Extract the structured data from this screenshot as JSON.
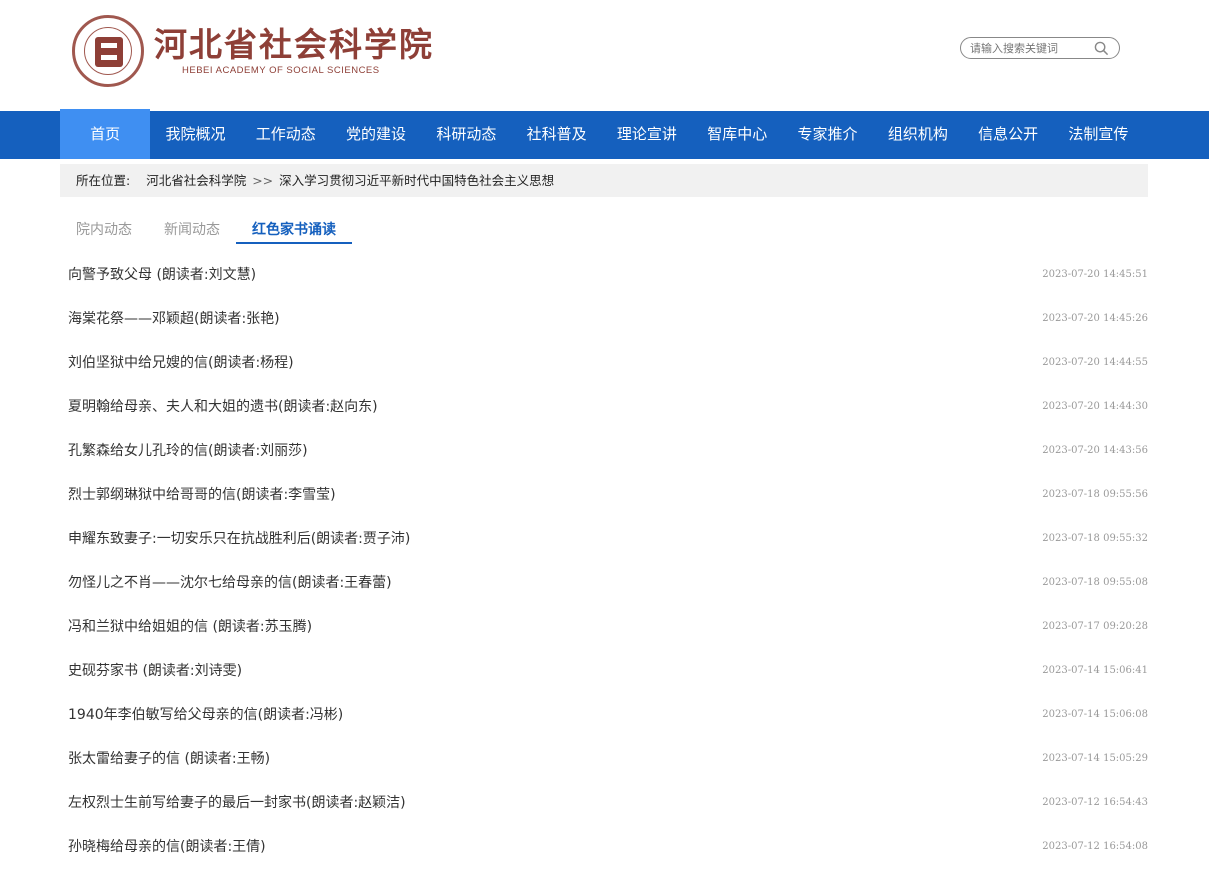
{
  "site": {
    "name_cn": "河北省社会科学院",
    "name_en": "HEBEI ACADEMY OF SOCIAL SCIENCES"
  },
  "search": {
    "placeholder": "请输入搜索关键词",
    "icon": "search-icon"
  },
  "nav": {
    "items": [
      {
        "label": "首页",
        "active": true
      },
      {
        "label": "我院概况"
      },
      {
        "label": "工作动态"
      },
      {
        "label": "党的建设"
      },
      {
        "label": "科研动态"
      },
      {
        "label": "社科普及"
      },
      {
        "label": "理论宣讲"
      },
      {
        "label": "智库中心"
      },
      {
        "label": "专家推介"
      },
      {
        "label": "组织机构"
      },
      {
        "label": "信息公开"
      },
      {
        "label": "法制宣传"
      }
    ]
  },
  "breadcrumb": {
    "label": "所在位置:",
    "home": "河北省社会科学院",
    "separator": ">>",
    "current": "深入学习贯彻习近平新时代中国特色社会主义思想"
  },
  "tabs": [
    {
      "label": "院内动态"
    },
    {
      "label": "新闻动态"
    },
    {
      "label": "红色家书诵读",
      "active": true
    }
  ],
  "articles": [
    {
      "title": "向警予致父母 (朗读者:刘文慧)",
      "date": "2023-07-20 14:45:51"
    },
    {
      "title": "海棠花祭——邓颖超(朗读者:张艳)",
      "date": "2023-07-20 14:45:26"
    },
    {
      "title": "刘伯坚狱中给兄嫂的信(朗读者:杨程)",
      "date": "2023-07-20 14:44:55"
    },
    {
      "title": "夏明翰给母亲、夫人和大姐的遗书(朗读者:赵向东)",
      "date": "2023-07-20 14:44:30"
    },
    {
      "title": "孔繁森给女儿孔玲的信(朗读者:刘丽莎)",
      "date": "2023-07-20 14:43:56"
    },
    {
      "title": "烈士郭纲琳狱中给哥哥的信(朗读者:李雪莹)",
      "date": "2023-07-18 09:55:56"
    },
    {
      "title": "申耀东致妻子:一切安乐只在抗战胜利后(朗读者:贾子沛)",
      "date": "2023-07-18 09:55:32"
    },
    {
      "title": "勿怪儿之不肖——沈尔七给母亲的信(朗读者:王春蕾)",
      "date": "2023-07-18 09:55:08"
    },
    {
      "title": "冯和兰狱中给姐姐的信 (朗读者:苏玉腾)",
      "date": "2023-07-17 09:20:28"
    },
    {
      "title": "史砚芬家书 (朗读者:刘诗雯)",
      "date": "2023-07-14 15:06:41"
    },
    {
      "title": "1940年李伯敏写给父母亲的信(朗读者:冯彬)",
      "date": "2023-07-14 15:06:08"
    },
    {
      "title": "张太雷给妻子的信 (朗读者:王畅)",
      "date": "2023-07-14 15:05:29"
    },
    {
      "title": "左权烈士生前写给妻子的最后一封家书(朗读者:赵颖洁)",
      "date": "2023-07-12 16:54:43"
    },
    {
      "title": "孙晓梅给母亲的信(朗读者:王倩)",
      "date": "2023-07-12 16:54:08"
    }
  ],
  "colors": {
    "nav_bg": "#1560be",
    "nav_active": "#3f8ff2",
    "brand": "#8e3f37",
    "tab_active": "#1560be"
  }
}
